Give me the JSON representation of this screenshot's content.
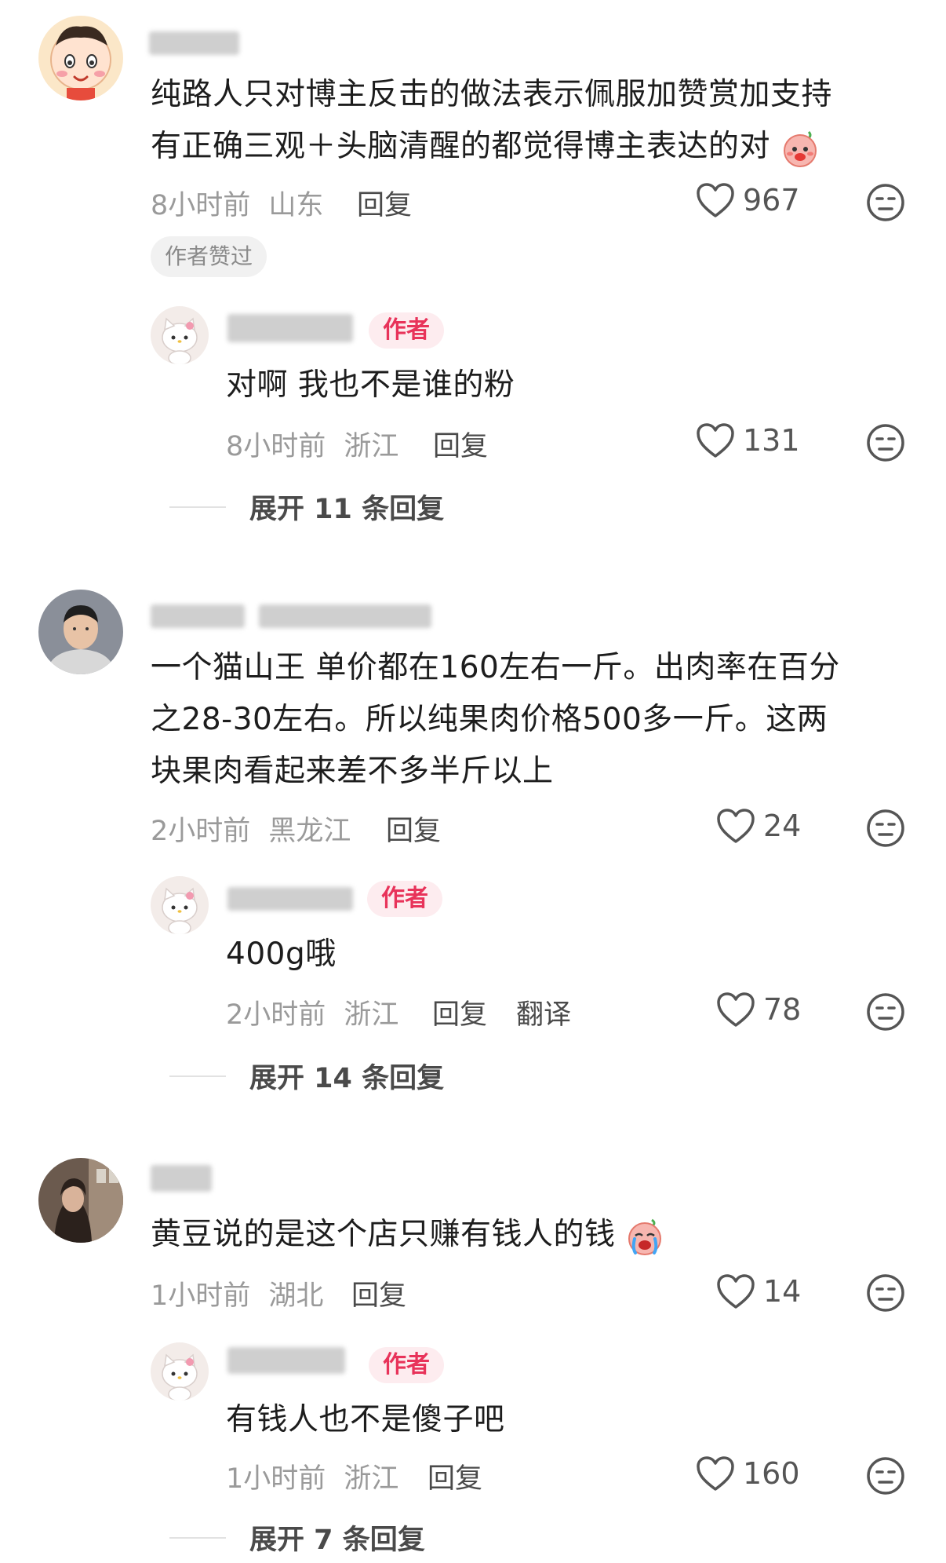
{
  "colors": {
    "author_tag_bg": "#fdecef",
    "author_tag_text": "#e8335a",
    "meta": "#9a9a9a"
  },
  "comments": [
    {
      "text_lines": [
        "纯路人只对博主反击的做法表示佩服加赞赏加支持",
        "有正确三观＋头脑清醒的都觉得博主表达的对"
      ],
      "time": "8小时前",
      "location": "山东",
      "reply_label": "回复",
      "likes": "967",
      "badge": "作者赞过",
      "reply": {
        "tag": "作者",
        "text": "对啊 我也不是谁的粉",
        "time": "8小时前",
        "location": "浙江",
        "reply_label": "回复",
        "likes": "131"
      },
      "expand": "展开 11 条回复"
    },
    {
      "text_lines": [
        "一个猫山王 单价都在160左右一斤。出肉率在百分",
        "之28-30左右。所以纯果肉价格500多一斤。这两",
        "块果肉看起来差不多半斤以上"
      ],
      "time": "2小时前",
      "location": "黑龙江",
      "reply_label": "回复",
      "likes": "24",
      "reply": {
        "tag": "作者",
        "text": "400g哦",
        "time": "2小时前",
        "location": "浙江",
        "reply_label": "回复",
        "translate_label": "翻译",
        "likes": "78"
      },
      "expand": "展开 14 条回复"
    },
    {
      "text_lines": [
        "黄豆说的是这个店只赚有钱人的钱"
      ],
      "time": "1小时前",
      "location": "湖北",
      "reply_label": "回复",
      "likes": "14",
      "reply": {
        "tag": "作者",
        "text": "有钱人也不是傻子吧",
        "time": "1小时前",
        "location": "浙江",
        "reply_label": "回复",
        "likes": "160"
      },
      "expand": "展开 7 条回复"
    }
  ]
}
